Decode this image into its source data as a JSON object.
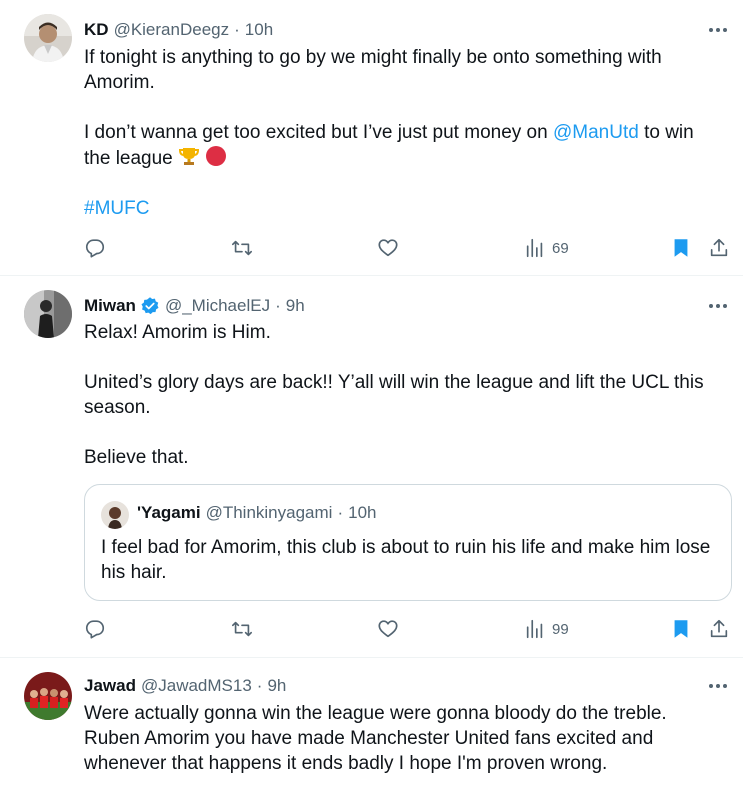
{
  "tweets": [
    {
      "name": "KD",
      "handle": "@KieranDeegz",
      "time": "10h",
      "lines": [
        "If tonight is anything to go by we might finally be onto something with Amorim.",
        "I don’t wanna get too excited but I’ve just put money on",
        "@ManUtd",
        "to win the league",
        "#MUFC"
      ],
      "views": "69",
      "bookmarked": true
    },
    {
      "name": "Miwan",
      "handle": "@_MichaelEJ",
      "time": "9h",
      "verified": true,
      "lines": [
        "Relax! Amorim is Him.",
        "United’s glory days are back!! Y’all will win the league and lift the UCL this season.",
        "Believe that."
      ],
      "quote": {
        "name": "'Yagami",
        "handle": "@Thinkinyagami",
        "time": "10h",
        "text": "I feel bad for Amorim, this club is about to ruin his life and make him lose his hair."
      },
      "views": "99",
      "bookmarked": true
    },
    {
      "name": "Jawad",
      "handle": "@JawadMS13",
      "time": "9h",
      "lines": [
        "Were actually gonna win the league were gonna bloody do the treble. Ruben Amorim you have made Manchester United fans excited and whenever that happens it ends badly I hope I'm proven wrong."
      ]
    }
  ],
  "separator": "·",
  "icons": {
    "reply": "reply-icon",
    "retweet": "retweet-icon",
    "like": "heart-icon",
    "views": "views-icon",
    "bookmark": "bookmark-icon",
    "share": "share-icon",
    "more": "more-icon",
    "verified": "verified-badge-icon"
  },
  "colors": {
    "accent": "#1d9bf0",
    "secondary_text": "#536471",
    "divider": "#eff3f4"
  }
}
